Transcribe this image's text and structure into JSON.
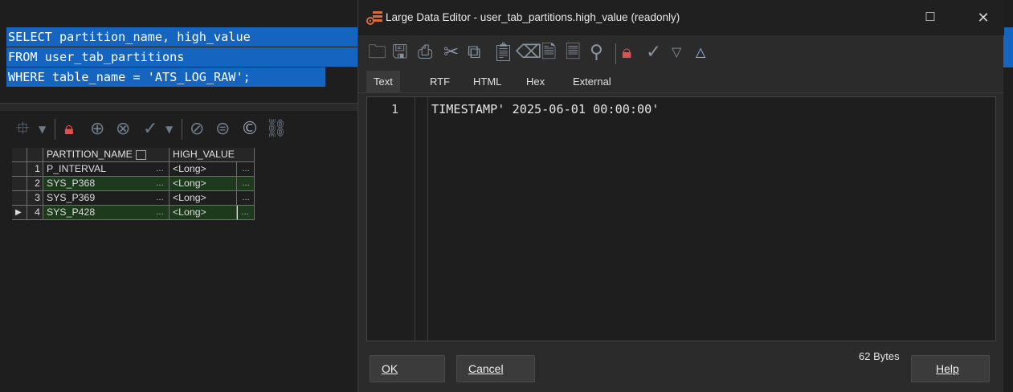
{
  "sql": {
    "lines": [
      "SELECT partition_name, high_value",
      "FROM user_tab_partitions",
      "WHERE table_name = 'ATS_LOG_RAW';"
    ]
  },
  "grid": {
    "columns": [
      "PARTITION_NAME",
      "HIGH_VALUE"
    ],
    "rows": [
      {
        "num": "1",
        "name": "P_INTERVAL",
        "high_value": "<Long>",
        "style": "dark"
      },
      {
        "num": "2",
        "name": "SYS_P368",
        "high_value": "<Long>",
        "style": "green"
      },
      {
        "num": "3",
        "name": "SYS_P369",
        "high_value": "<Long>",
        "style": "dark"
      },
      {
        "num": "4",
        "name": "SYS_P428",
        "high_value": "<Long>",
        "style": "green",
        "current": true
      }
    ],
    "ellipsis": "…"
  },
  "dialog": {
    "title": "Large Data Editor - user_tab_partitions.high_value (readonly)",
    "tabs": [
      "Text",
      "RTF",
      "HTML",
      "Hex",
      "External"
    ],
    "active_tab": "Text",
    "line_number": "1",
    "content": "TIMESTAMP' 2025-06-01 00:00:00'",
    "byte_count": "62 Bytes",
    "ok_label": "OK",
    "cancel_label": "Cancel",
    "help_label": "Help"
  },
  "icons": {
    "accent_selection": "#1565c0",
    "row_highlight": "#1d3a1d",
    "lock_color": "#e05050"
  }
}
